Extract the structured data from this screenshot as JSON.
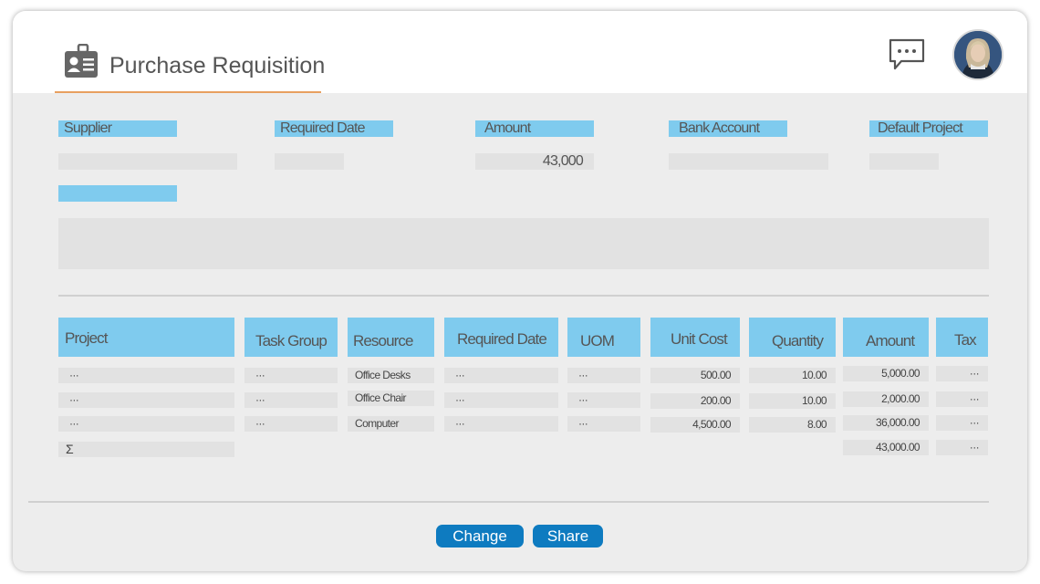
{
  "header": {
    "title": "Purchase Requisition"
  },
  "form": {
    "supplier_label": "Supplier",
    "required_date_label": "Required Date",
    "amount_label": "Amount",
    "amount_value": "43,000",
    "bank_account_label": "Bank Account",
    "default_project_label": "Default Project"
  },
  "table": {
    "columns": [
      "Project",
      "Task Group",
      "Resource",
      "Required Date",
      "UOM",
      "Unit Cost",
      "Quantity",
      "Amount",
      "Tax"
    ],
    "rows": [
      {
        "project": "···",
        "task_group": "···",
        "resource": "Office Desks",
        "required_date": "···",
        "uom": "···",
        "unit_cost": "500.00",
        "quantity": "10.00",
        "amount": "5,000.00",
        "tax": "···"
      },
      {
        "project": "···",
        "task_group": "···",
        "resource": "Office Chair",
        "required_date": "···",
        "uom": "···",
        "unit_cost": "200.00",
        "quantity": "10.00",
        "amount": "2,000.00",
        "tax": "···"
      },
      {
        "project": "···",
        "task_group": "···",
        "resource": "Computer",
        "required_date": "···",
        "uom": "···",
        "unit_cost": "4,500.00",
        "quantity": "8.00",
        "amount": "36,000.00",
        "tax": "···"
      }
    ],
    "total": {
      "symbol": "Σ",
      "amount": "43,000.00",
      "tax": "···"
    }
  },
  "actions": {
    "change_label": "Change",
    "share_label": "Share"
  },
  "colors": {
    "label_bg": "#7fcbee",
    "field_bg": "#e2e2e2",
    "accent_underline": "#e8a060",
    "button_bg": "#0e7bc0"
  }
}
